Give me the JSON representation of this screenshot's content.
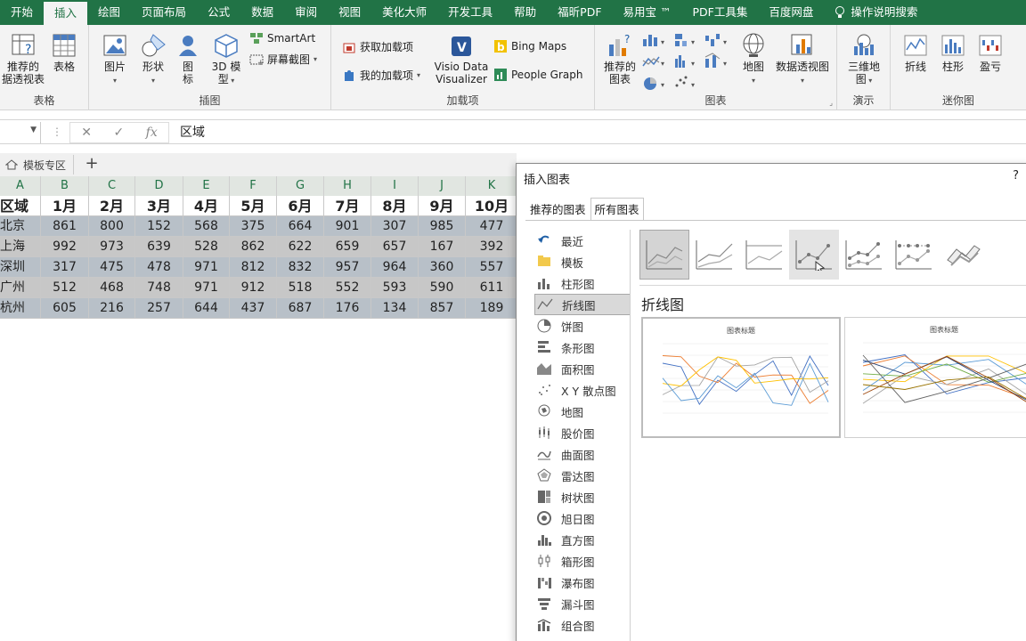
{
  "tabs": [
    {
      "label": "开始",
      "active": false
    },
    {
      "label": "插入",
      "active": true
    },
    {
      "label": "绘图",
      "active": false
    },
    {
      "label": "页面布局",
      "active": false
    },
    {
      "label": "公式",
      "active": false
    },
    {
      "label": "数据",
      "active": false
    },
    {
      "label": "审阅",
      "active": false
    },
    {
      "label": "视图",
      "active": false
    },
    {
      "label": "美化大师",
      "active": false
    },
    {
      "label": "开发工具",
      "active": false
    },
    {
      "label": "帮助",
      "active": false
    },
    {
      "label": "福昕PDF",
      "active": false
    },
    {
      "label": "易用宝 ™",
      "active": false
    },
    {
      "label": "PDF工具集",
      "active": false
    },
    {
      "label": "百度网盘",
      "active": false
    }
  ],
  "search_label": "操作说明搜索",
  "ribbon": {
    "tables": {
      "label": "表格",
      "pivot_line1": "推荐的",
      "pivot_line2": "据透视表",
      "table": "表格"
    },
    "illustrations": {
      "label": "插图",
      "pictures": "图片",
      "shapes": "形状",
      "icons_1": "图",
      "icons_2": "标",
      "model3d_1": "3D 模",
      "model3d_2": "型",
      "smartart": "SmartArt",
      "screenshot": "屏幕截图"
    },
    "addins": {
      "label": "加载项",
      "get": "获取加载项",
      "my": "我的加载项",
      "visio_1": "Visio Data",
      "visio_2": "Visualizer",
      "bing": "Bing Maps",
      "people": "People Graph"
    },
    "charts": {
      "label": "图表",
      "recommended_1": "推荐的",
      "recommended_2": "图表",
      "map": "地图",
      "pivotchart": "数据透视图"
    },
    "tours": {
      "label": "演示",
      "map3d_1": "三维地",
      "map3d_2": "图"
    },
    "sparklines": {
      "label": "迷你图",
      "line": "折线",
      "column": "柱形",
      "winloss": "盈亏"
    }
  },
  "formula_bar": {
    "value": "区域"
  },
  "sheet_tab": "模板专区",
  "grid": {
    "columns": [
      "A",
      "B",
      "C",
      "D",
      "E",
      "F",
      "G",
      "H",
      "I",
      "J",
      "K"
    ],
    "header": [
      "区域",
      "1月",
      "2月",
      "3月",
      "4月",
      "5月",
      "6月",
      "7月",
      "8月",
      "9月",
      "10月"
    ],
    "rows": [
      [
        "北京",
        "861",
        "800",
        "152",
        "568",
        "375",
        "664",
        "901",
        "307",
        "985",
        "477"
      ],
      [
        "上海",
        "992",
        "973",
        "639",
        "528",
        "862",
        "622",
        "659",
        "657",
        "167",
        "392"
      ],
      [
        "深圳",
        "317",
        "475",
        "478",
        "971",
        "812",
        "832",
        "957",
        "964",
        "360",
        "557"
      ],
      [
        "广州",
        "512",
        "468",
        "748",
        "971",
        "912",
        "518",
        "552",
        "593",
        "590",
        "611"
      ],
      [
        "杭州",
        "605",
        "216",
        "257",
        "644",
        "437",
        "687",
        "176",
        "134",
        "857",
        "189"
      ]
    ]
  },
  "dialog": {
    "title": "插入图表",
    "help": "?",
    "tab_recommended": "推荐的图表",
    "tab_all": "所有图表",
    "categories": [
      "最近",
      "模板",
      "柱形图",
      "折线图",
      "饼图",
      "条形图",
      "面积图",
      "X Y 散点图",
      "地图",
      "股价图",
      "曲面图",
      "雷达图",
      "树状图",
      "旭日图",
      "直方图",
      "箱形图",
      "瀑布图",
      "漏斗图",
      "组合图"
    ],
    "active_category": "折线图",
    "section_title": "折线图",
    "preview_title": "图表标题"
  }
}
